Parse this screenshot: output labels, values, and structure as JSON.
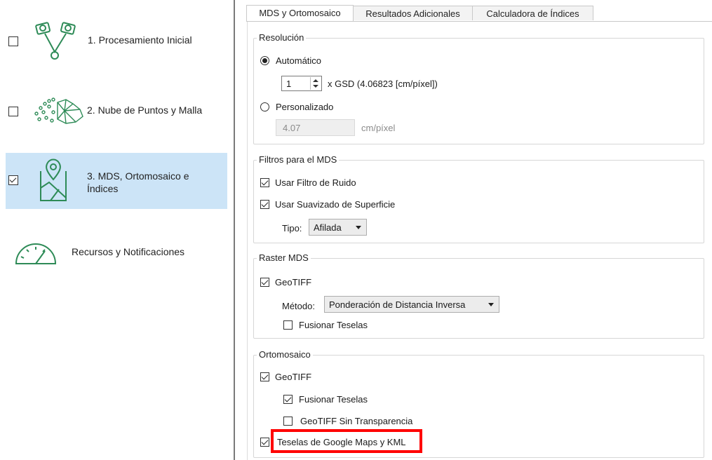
{
  "sidebar": {
    "steps": [
      {
        "label": "1. Procesamiento Inicial",
        "checked": false,
        "icon": "drone-processing-icon"
      },
      {
        "label": "2. Nube de Puntos y Malla",
        "checked": false,
        "icon": "point-cloud-mesh-icon"
      },
      {
        "label_line1": "3. MDS, Ortomosaico e",
        "label_line2": "Índices",
        "checked": true,
        "selected": true,
        "icon": "map-pin-icon"
      },
      {
        "label": "Recursos y Notificaciones",
        "icon": "gauge-icon"
      }
    ]
  },
  "tabs": [
    "MDS y Ortomosaico",
    "Resultados Adicionales",
    "Calculadora de Índices"
  ],
  "resolution": {
    "title": "Resolución",
    "auto_label": "Automático",
    "gsd_value": "1",
    "gsd_text": "x GSD (4.06823 [cm/píxel])",
    "custom_label": "Personalizado",
    "custom_value": "4.07",
    "custom_unit": "cm/píxel"
  },
  "mds_filters": {
    "title": "Filtros para el MDS",
    "noise_label": "Usar Filtro de Ruido",
    "smooth_label": "Usar Suavizado de Superficie",
    "type_label": "Tipo:",
    "type_value": "Afilada"
  },
  "raster_mds": {
    "title": "Raster MDS",
    "geotiff_label": "GeoTIFF",
    "method_label": "Método:",
    "method_value": "Ponderación de Distancia Inversa",
    "merge_label": "Fusionar Teselas"
  },
  "orthomosaic": {
    "title": "Ortomosaico",
    "geotiff_label": "GeoTIFF",
    "merge_label": "Fusionar Teselas",
    "no_transparency_label": "GeoTIFF Sin Transparencia",
    "google_label": "Teselas de Google Maps y KML"
  },
  "colors": {
    "selected_bg": "#cce4f7",
    "icon_green": "#2e8b57",
    "highlight_red": "#ff0000"
  }
}
